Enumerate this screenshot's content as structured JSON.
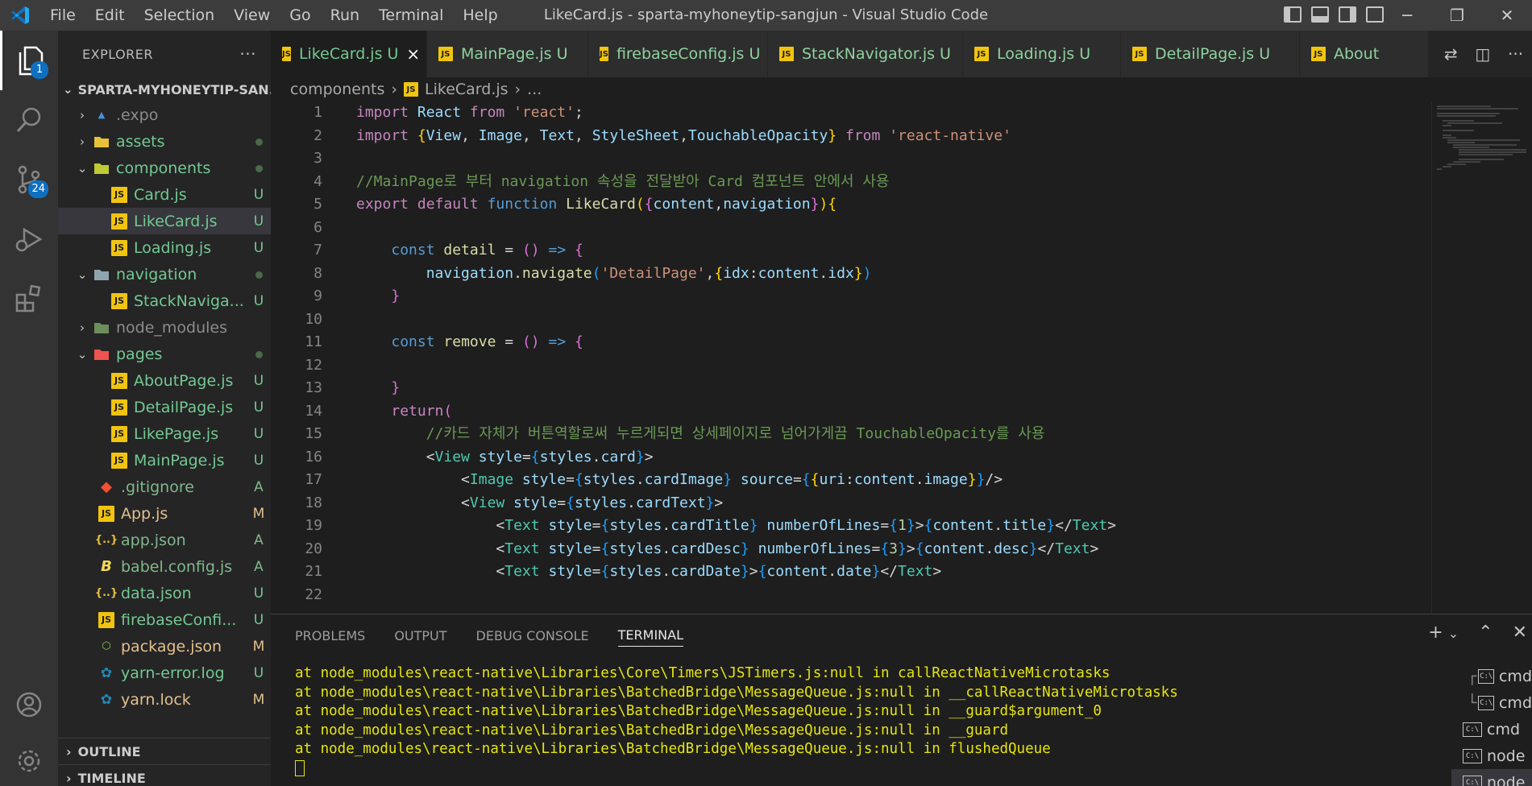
{
  "titlebar": {
    "menu": [
      "File",
      "Edit",
      "Selection",
      "View",
      "Go",
      "Run",
      "Terminal",
      "Help"
    ],
    "title": "LikeCard.js - sparta-myhoneytip-sangjun - Visual Studio Code"
  },
  "activity": {
    "explorer_badge": "1",
    "scm_badge": "24"
  },
  "sidebar": {
    "header": "EXPLORER",
    "more": "···",
    "folder": "SPARTA-MYHONEYTIP-SAN...",
    "items": [
      {
        "name": ".expo",
        "status": ""
      },
      {
        "name": "assets",
        "status": ""
      },
      {
        "name": "components",
        "status": ""
      },
      {
        "name": "Card.js",
        "status": "U"
      },
      {
        "name": "LikeCard.js",
        "status": "U"
      },
      {
        "name": "Loading.js",
        "status": "U"
      },
      {
        "name": "navigation",
        "status": ""
      },
      {
        "name": "StackNaviga...",
        "status": "U"
      },
      {
        "name": "node_modules",
        "status": ""
      },
      {
        "name": "pages",
        "status": ""
      },
      {
        "name": "AboutPage.js",
        "status": "U"
      },
      {
        "name": "DetailPage.js",
        "status": "U"
      },
      {
        "name": "LikePage.js",
        "status": "U"
      },
      {
        "name": "MainPage.js",
        "status": "U"
      },
      {
        "name": ".gitignore",
        "status": "A"
      },
      {
        "name": "App.js",
        "status": "M"
      },
      {
        "name": "app.json",
        "status": "A"
      },
      {
        "name": "babel.config.js",
        "status": "A"
      },
      {
        "name": "data.json",
        "status": "U"
      },
      {
        "name": "firebaseConfi...",
        "status": "U"
      },
      {
        "name": "package.json",
        "status": "M"
      },
      {
        "name": "yarn-error.log",
        "status": "U"
      },
      {
        "name": "yarn.lock",
        "status": "M"
      }
    ],
    "outline": "OUTLINE",
    "timeline": "TIMELINE"
  },
  "tabs": [
    {
      "label": "LikeCard.js",
      "status": "U",
      "close": "×"
    },
    {
      "label": "MainPage.js",
      "status": "U"
    },
    {
      "label": "firebaseConfig.js",
      "status": "U"
    },
    {
      "label": "StackNavigator.js",
      "status": "U"
    },
    {
      "label": "Loading.js",
      "status": "U"
    },
    {
      "label": "DetailPage.js",
      "status": "U"
    },
    {
      "label": "About",
      "status": ""
    }
  ],
  "breadcrumb": {
    "folder": "components",
    "file": "LikeCard.js",
    "more": "..."
  },
  "editor": {
    "line_numbers": [
      "1",
      "2",
      "3",
      "4",
      "5",
      "6",
      "7",
      "8",
      "9",
      "10",
      "11",
      "12",
      "13",
      "14",
      "15",
      "16",
      "17",
      "18",
      "19",
      "20",
      "21",
      "22"
    ]
  },
  "panel": {
    "tabs": [
      "PROBLEMS",
      "OUTPUT",
      "DEBUG CONSOLE",
      "TERMINAL"
    ],
    "terminal_lines": [
      "at node_modules\\react-native\\Libraries\\Core\\Timers\\JSTimers.js:null in callReactNativeMicrotasks",
      "at node_modules\\react-native\\Libraries\\BatchedBridge\\MessageQueue.js:null in __callReactNativeMicrotasks",
      "at node_modules\\react-native\\Libraries\\BatchedBridge\\MessageQueue.js:null in __guard$argument_0",
      "at node_modules\\react-native\\Libraries\\BatchedBridge\\MessageQueue.js:null in __guard",
      "at node_modules\\react-native\\Libraries\\BatchedBridge\\MessageQueue.js:null in flushedQueue"
    ],
    "terminals": [
      "cmd",
      "cmd",
      "cmd",
      "node",
      "node"
    ]
  },
  "colors": {
    "accent": "#0e70c0",
    "untracked": "#73c991",
    "modified": "#e2c08d",
    "terminal_text": "#e5e510"
  }
}
